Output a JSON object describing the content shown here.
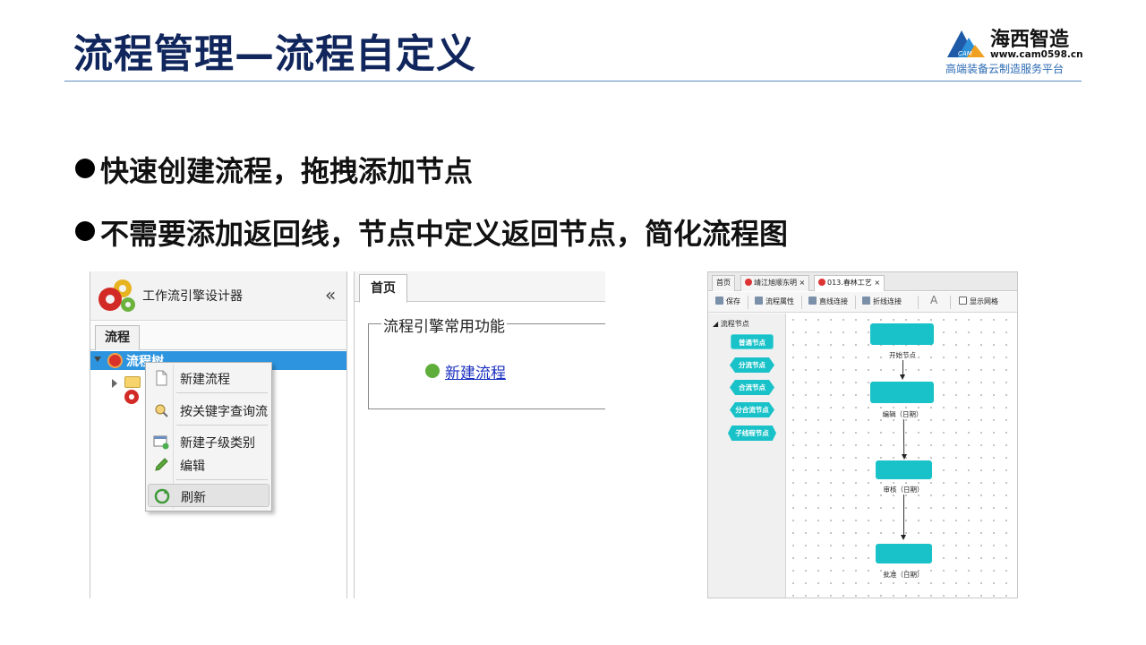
{
  "slide": {
    "title": "流程管理—流程自定义",
    "logo": {
      "name": "海西智造",
      "url": "www.cam0598.cn",
      "slogan": "高端装备云制造服务平台",
      "mark_text": "CAM"
    },
    "bullets": [
      "快速创建流程，拖拽添加节点",
      "不需要添加返回线，节点中定义返回节点，简化流程图"
    ]
  },
  "designer": {
    "sidebar_title": "工作流引擎设计器",
    "collapse_glyph": "«",
    "sidebar_tab": "流程",
    "tree": {
      "root_label": "流程树"
    },
    "context_menu": {
      "items": [
        "新建流程",
        "按关键字查询流",
        "新建子级类别",
        "编辑",
        "刷新"
      ]
    },
    "main_tab": "首页",
    "fieldset_legend": "流程引擎常用功能",
    "new_flow_link": "新建流程"
  },
  "editor": {
    "tabs": [
      "首页",
      "靖江旭顺东明 ×",
      "013.春林工艺 ×"
    ],
    "toolbar": [
      "保存",
      "流程属性",
      "直线连接",
      "折线连接",
      "显示网格"
    ],
    "font_button": "A",
    "palette_title": "流程节点",
    "palette": [
      "普通节点",
      "分流节点",
      "合流节点",
      "分合流节点",
      "子线程节点"
    ],
    "nodes": [
      "开始节点",
      "编辑（日期）",
      "审核（日期）",
      "批准（日期）"
    ],
    "colors": {
      "node": "#19c2c8"
    }
  }
}
